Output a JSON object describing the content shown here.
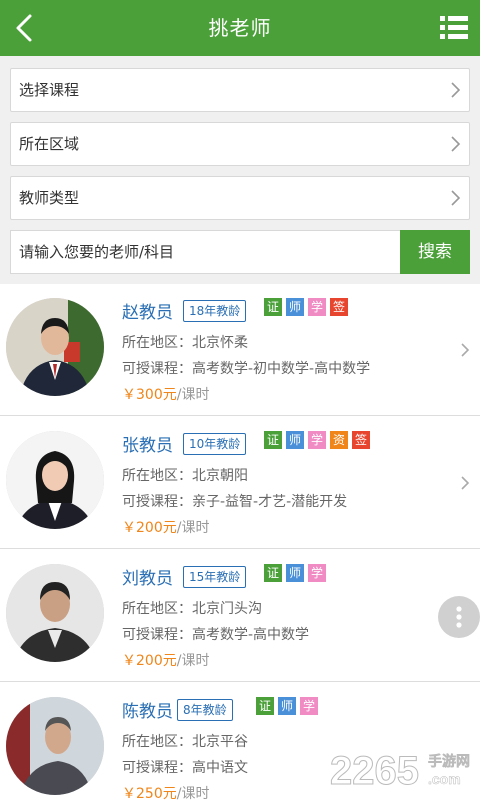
{
  "header": {
    "title": "挑老师",
    "back_icon": "chevron-left-icon",
    "menu_icon": "list-menu-icon"
  },
  "filters": [
    {
      "label": "选择课程"
    },
    {
      "label": "所在区域"
    },
    {
      "label": "教师类型"
    }
  ],
  "search": {
    "placeholder": "请输入您要的老师/科目",
    "button_label": "搜索"
  },
  "teachers": [
    {
      "name": "赵教员",
      "years": "18年教龄",
      "tags": [
        {
          "text": "证",
          "color": "#4ba03a"
        },
        {
          "text": "师",
          "color": "#4a90d9"
        },
        {
          "text": "学",
          "color": "#f08bc4"
        },
        {
          "text": "签",
          "color": "#e8452f"
        }
      ],
      "area": "所在地区：北京怀柔",
      "courses": "可授课程：高考数学-初中数学-高中数学",
      "price_amount": "￥300元",
      "price_unit": "/课时"
    },
    {
      "name": "张教员",
      "years": "10年教龄",
      "tags": [
        {
          "text": "证",
          "color": "#4ba03a"
        },
        {
          "text": "师",
          "color": "#4a90d9"
        },
        {
          "text": "学",
          "color": "#f08bc4"
        },
        {
          "text": "资",
          "color": "#f08519"
        },
        {
          "text": "签",
          "color": "#e8452f"
        }
      ],
      "area": "所在地区：北京朝阳",
      "courses": "可授课程：亲子-益智-才艺-潜能开发",
      "price_amount": "￥200元",
      "price_unit": "/课时"
    },
    {
      "name": "刘教员",
      "years": "15年教龄",
      "tags": [
        {
          "text": "证",
          "color": "#4ba03a"
        },
        {
          "text": "师",
          "color": "#4a90d9"
        },
        {
          "text": "学",
          "color": "#f08bc4"
        }
      ],
      "area": "所在地区：北京门头沟",
      "courses": "可授课程：高考数学-高中数学",
      "price_amount": "￥200元",
      "price_unit": "/课时"
    },
    {
      "name": "陈教员",
      "years": "8年教龄",
      "tags": [
        {
          "text": "证",
          "color": "#4ba03a"
        },
        {
          "text": "师",
          "color": "#4a90d9"
        },
        {
          "text": "学",
          "color": "#f08bc4"
        }
      ],
      "area": "所在地区：北京平谷",
      "courses": "可授课程：高中语文",
      "price_amount": "￥250元",
      "price_unit": "/课时"
    }
  ],
  "watermark": {
    "number": "2265",
    "dot_com": ".com",
    "site": "手游网"
  },
  "colors": {
    "brand_green": "#4ba03a",
    "name_blue": "#2a6fb4",
    "price_orange": "#f08519"
  }
}
